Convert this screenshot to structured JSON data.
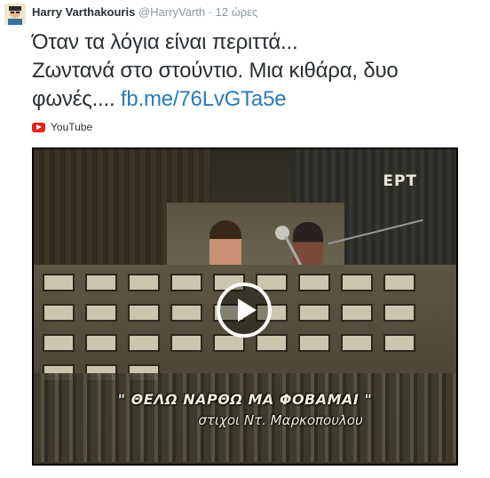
{
  "tweet": {
    "author_name": "Harry Varthakouris",
    "author_handle": "@HarryVarth",
    "separator": "·",
    "time": "12 ώρες",
    "text_line1": "Όταν τα λόγια είναι περιττά...",
    "text_line2": "Ζωντανά στο στούντιο. Μια κιθάρα, δυο",
    "text_line3": "φωνές....",
    "link": "fb.me/76LvGTa5e"
  },
  "card": {
    "source": "YouTube",
    "source_icon": "youtube-icon",
    "video": {
      "channel_watermark": "ΕΡΤ",
      "caption_line1": "\" ΘΕΛΩ ΝΑΡΘΩ ΜΑ ΦΟΒΑΜΑΙ \"",
      "caption_line2": "στιχοι Ντ. Μαρκοπουλου",
      "play_icon": "play-icon"
    }
  },
  "colors": {
    "link": "#2b7bb9",
    "youtube_red": "#e62117",
    "muted": "#8899a6",
    "text": "#292f33"
  }
}
